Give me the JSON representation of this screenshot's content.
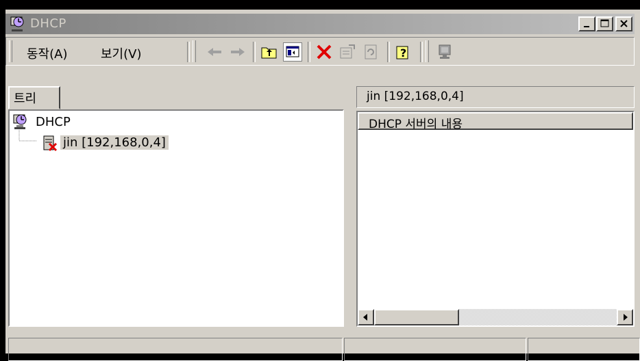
{
  "window": {
    "title": "DHCP"
  },
  "menu": {
    "action": "동작(A)",
    "view": "보기(V)"
  },
  "toolbar_icons": [
    "back-arrow-icon",
    "forward-arrow-icon",
    "up-folder-icon",
    "show-hide-tree-icon",
    "delete-icon",
    "properties-icon",
    "refresh-icon",
    "help-icon",
    "server-icon"
  ],
  "left_tab": {
    "label": "트리"
  },
  "tree": {
    "root": "DHCP",
    "children": [
      {
        "label": "jin [192,168,0,4]",
        "selected": true
      }
    ]
  },
  "right_panel": {
    "header": "jin [192,168,0,4]",
    "column": "DHCP 서버의 내용"
  },
  "colors": {
    "title_gradient_start": "#808080",
    "title_gradient_end": "#c0c0c0",
    "face": "#d4d0c8",
    "delete_red": "#e00000"
  }
}
